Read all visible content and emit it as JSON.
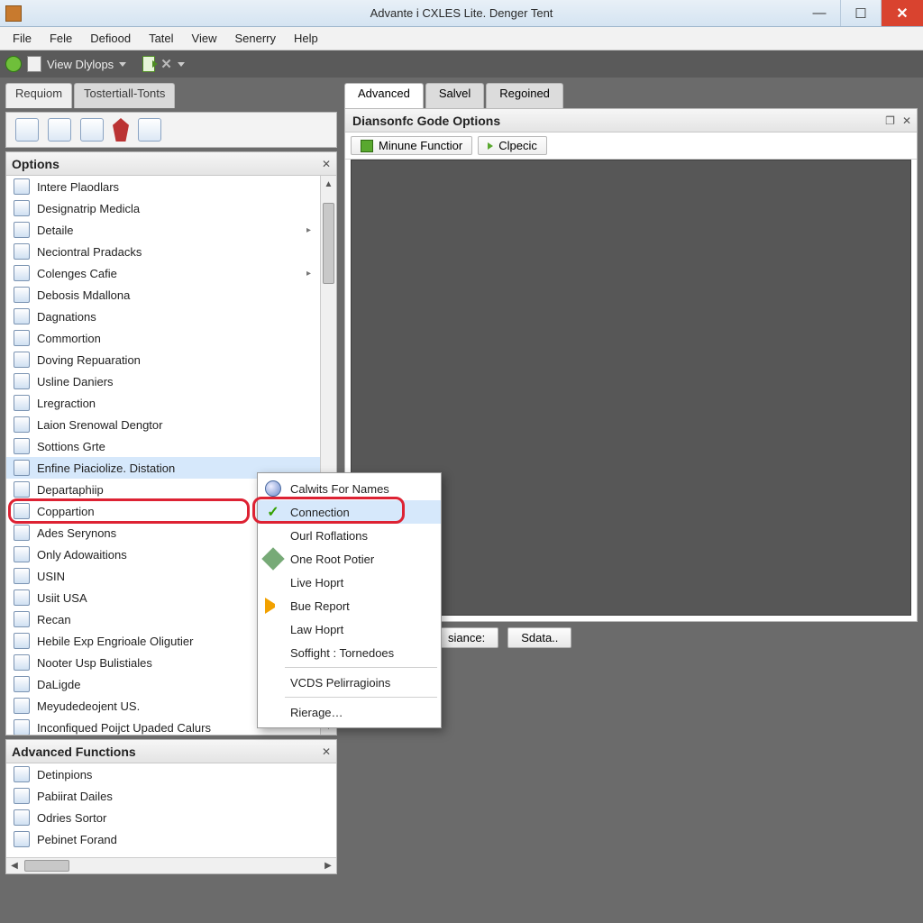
{
  "window": {
    "title": "Advante i CXLES Lite. Denger Tent"
  },
  "menubar": [
    "File",
    "Fele",
    "Defiood",
    "Tatel",
    "View",
    "Senerry",
    "Help"
  ],
  "toolbar": {
    "viewLabel": "View Dlylops"
  },
  "leftTabs": [
    "Requiom",
    "Tostertiall-Tonts"
  ],
  "optionsPanel": {
    "title": "Options",
    "items": [
      {
        "label": "Intere Plaodlars",
        "icon": "green"
      },
      {
        "label": "Designatrip Medicla",
        "icon": "blue",
        "selected": false
      },
      {
        "label": "Detaile",
        "icon": "gray",
        "chev": true
      },
      {
        "label": "Neciontral Pradacks",
        "icon": "gray"
      },
      {
        "label": "Colenges Cafie",
        "icon": "green",
        "chev": true
      },
      {
        "label": "Debosis Mdallona",
        "icon": "blue"
      },
      {
        "label": "Dagnations",
        "icon": "blue"
      },
      {
        "label": "Commortion",
        "icon": "blue"
      },
      {
        "label": "Doving Repuaration",
        "icon": "blue"
      },
      {
        "label": "Usline Daniers",
        "icon": "blue"
      },
      {
        "label": "Lregraction",
        "icon": "blue"
      },
      {
        "label": "Laion Srenowal Dengtor",
        "icon": "redv"
      },
      {
        "label": "Sottions Grte",
        "icon": "gray"
      },
      {
        "label": "Enfine Piaciolize. Distation",
        "icon": "blue",
        "selected": true
      },
      {
        "label": "Departaphiip",
        "icon": "blue"
      },
      {
        "label": "Coppartion",
        "icon": "gray",
        "redbox": true
      },
      {
        "label": "Ades Serynons",
        "icon": "orange"
      },
      {
        "label": "Only Adowaitions",
        "icon": "gray"
      },
      {
        "label": "USIN",
        "icon": "blue"
      },
      {
        "label": "Usiit USA",
        "icon": "green"
      },
      {
        "label": "Recan",
        "icon": "green"
      },
      {
        "label": "Hebile Exp Engrioale Oligutier",
        "icon": "blue circle"
      },
      {
        "label": "Nooter Usp Bulistiales",
        "icon": "orange"
      },
      {
        "label": "DaLigde",
        "icon": "redv"
      },
      {
        "label": "Meyudedeojent US.",
        "icon": "green circle"
      },
      {
        "label": "Inconfiqued Poijct Upaded Calurs",
        "icon": "gray"
      }
    ]
  },
  "advancedPanel": {
    "title": "Advanced Functions",
    "items": [
      {
        "label": "Detinpions",
        "icon": "orange"
      },
      {
        "label": "Pabiirat Dailes",
        "icon": "blue"
      },
      {
        "label": "Odries Sortor",
        "icon": "gray"
      },
      {
        "label": "Pebinet Forand",
        "icon": "gray"
      }
    ]
  },
  "contextMenu": {
    "items": [
      {
        "label": "Calwits For Names",
        "icon": "globe"
      },
      {
        "label": "Connection",
        "icon": "check",
        "hl": true,
        "redbox": true
      },
      {
        "label": "Ourl Roflations"
      },
      {
        "label": "One Root Potier",
        "icon": "wrench"
      },
      {
        "label": "Live Hoprt"
      },
      {
        "label": "Bue Report",
        "icon": "play"
      },
      {
        "label": "Law Hoprt"
      },
      {
        "label": "Soffight : Tornedoes"
      },
      {
        "sep": true
      },
      {
        "label": "VCDS Pelirragioins"
      },
      {
        "sep": true
      },
      {
        "label": "Rierage…"
      }
    ]
  },
  "rightTabs": [
    "Advanced",
    "Salvel",
    "Regoined"
  ],
  "rightBox": {
    "title": "Diansonfc Gode Options",
    "toolbar": {
      "btn1": "Minune Functior",
      "btn2": "Clpecic"
    }
  },
  "rightBottom": [
    "siance:",
    "Sdata.."
  ]
}
